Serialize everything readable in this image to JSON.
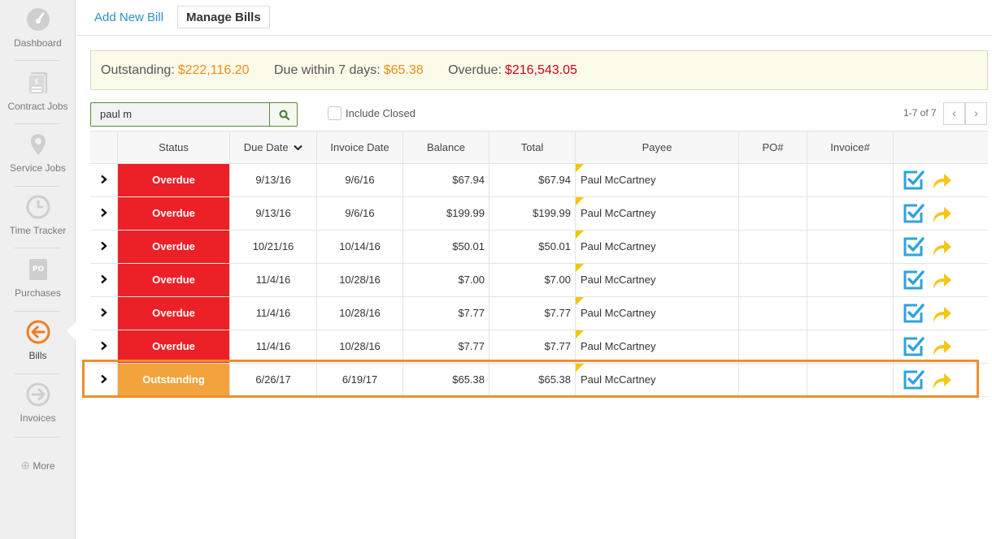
{
  "sidebar": {
    "items": [
      {
        "label": "Dashboard",
        "icon": "dashboard-icon"
      },
      {
        "label": "Contract Jobs",
        "icon": "contract-jobs-icon"
      },
      {
        "label": "Service Jobs",
        "icon": "location-pin-icon"
      },
      {
        "label": "Time Tracker",
        "icon": "clock-icon"
      },
      {
        "label": "Purchases",
        "icon": "purchase-order-icon"
      },
      {
        "label": "Bills",
        "icon": "bills-arrow-left-icon"
      },
      {
        "label": "Invoices",
        "icon": "invoices-arrow-right-icon"
      }
    ],
    "more": "More",
    "more_icon_glyph": "⊕",
    "active": "Bills"
  },
  "tabs": {
    "add": "Add New Bill",
    "manage": "Manage Bills"
  },
  "summary": {
    "outstanding_label": "Outstanding:",
    "outstanding_value": "$222,116.20",
    "due7_label": "Due within 7 days:",
    "due7_value": "$65.38",
    "overdue_label": "Overdue:",
    "overdue_value": "$216,543.05"
  },
  "search": {
    "value": "paul m"
  },
  "filters": {
    "include_closed": "Include Closed"
  },
  "pager": {
    "text": "1-7 of 7",
    "prev": "‹",
    "next": "›"
  },
  "table": {
    "headers": {
      "status": "Status",
      "due_date": "Due Date",
      "invoice_date": "Invoice Date",
      "balance": "Balance",
      "total": "Total",
      "payee": "Payee",
      "po": "PO#",
      "invoice_no": "Invoice#"
    },
    "rows": [
      {
        "status": "Overdue",
        "due_date": "9/13/16",
        "invoice_date": "9/6/16",
        "balance": "$67.94",
        "total": "$67.94",
        "payee": "Paul McCartney",
        "po": "",
        "invoice_no": ""
      },
      {
        "status": "Overdue",
        "due_date": "9/13/16",
        "invoice_date": "9/6/16",
        "balance": "$199.99",
        "total": "$199.99",
        "payee": "Paul McCartney",
        "po": "",
        "invoice_no": ""
      },
      {
        "status": "Overdue",
        "due_date": "10/21/16",
        "invoice_date": "10/14/16",
        "balance": "$50.01",
        "total": "$50.01",
        "payee": "Paul McCartney",
        "po": "",
        "invoice_no": ""
      },
      {
        "status": "Overdue",
        "due_date": "11/4/16",
        "invoice_date": "10/28/16",
        "balance": "$7.00",
        "total": "$7.00",
        "payee": "Paul McCartney",
        "po": "",
        "invoice_no": ""
      },
      {
        "status": "Overdue",
        "due_date": "11/4/16",
        "invoice_date": "10/28/16",
        "balance": "$7.77",
        "total": "$7.77",
        "payee": "Paul McCartney",
        "po": "",
        "invoice_no": ""
      },
      {
        "status": "Overdue",
        "due_date": "11/4/16",
        "invoice_date": "10/28/16",
        "balance": "$7.77",
        "total": "$7.77",
        "payee": "Paul McCartney",
        "po": "",
        "invoice_no": ""
      },
      {
        "status": "Outstanding",
        "due_date": "6/26/17",
        "invoice_date": "6/19/17",
        "balance": "$65.38",
        "total": "$65.38",
        "payee": "Paul McCartney",
        "po": "",
        "invoice_no": ""
      }
    ]
  },
  "colors": {
    "overdue": "#ec2027",
    "outstanding": "#f3a33e",
    "highlight": "#ef8f2f",
    "link": "#2f8fc6",
    "action_check": "#2ea3dc",
    "action_forward": "#f5c518"
  }
}
